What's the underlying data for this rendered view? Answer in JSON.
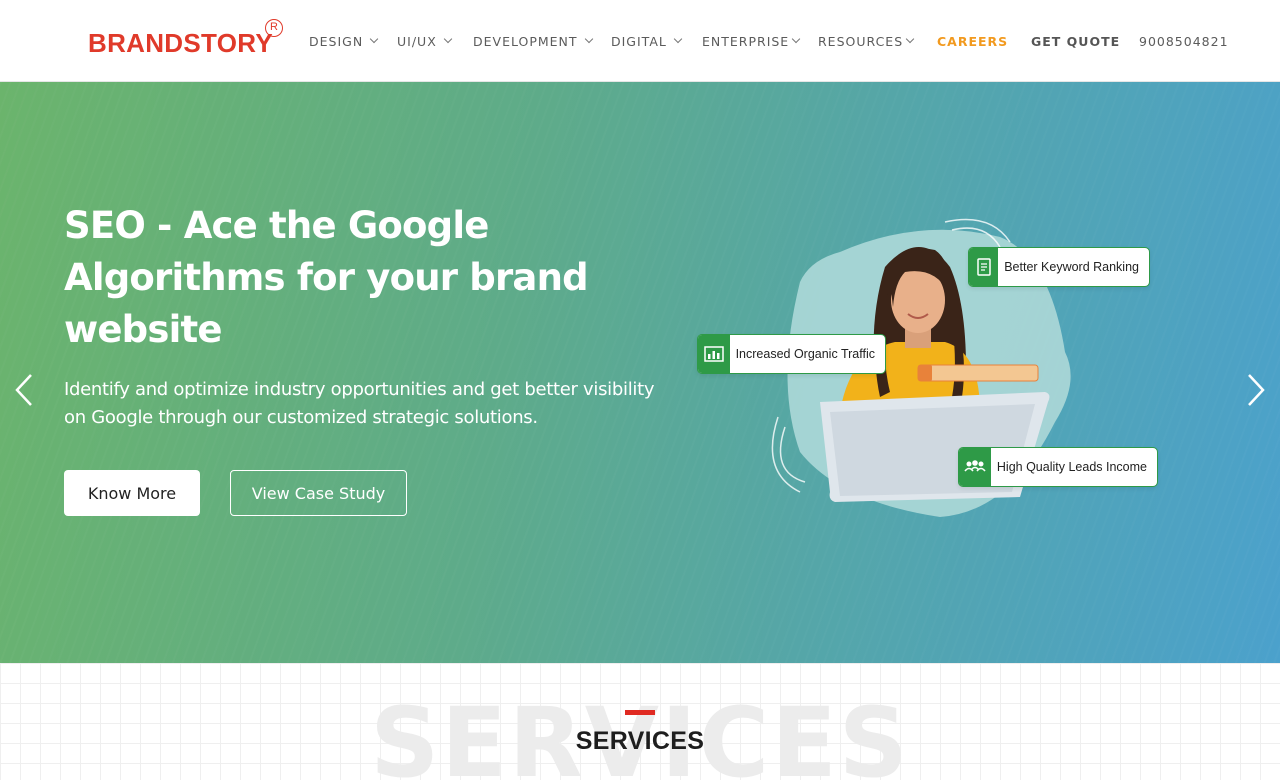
{
  "header": {
    "logo_text": "BRANDSTORY",
    "logo_reg": "R",
    "nav": [
      {
        "label": "DESIGN",
        "has_dropdown": true
      },
      {
        "label": "UI/UX",
        "has_dropdown": true
      },
      {
        "label": "DEVELOPMENT",
        "has_dropdown": true
      },
      {
        "label": "DIGITAL",
        "has_dropdown": true
      },
      {
        "label": "ENTERPRISE",
        "has_dropdown": true
      },
      {
        "label": "RESOURCES",
        "has_dropdown": true
      }
    ],
    "careers": "CAREERS",
    "get_quote": "GET QUOTE",
    "phone": "9008504821"
  },
  "hero": {
    "title": "SEO - Ace the Google Algorithms for your brand website",
    "subtitle": "Identify and optimize industry opportunities and get better visibility on Google through our customized strategic solutions.",
    "primary_button": "Know More",
    "secondary_button": "View Case Study",
    "badges": {
      "keyword": "Better Keyword Ranking",
      "traffic": "Increased Organic Traffic",
      "leads": "High Quality Leads Income"
    }
  },
  "services": {
    "background_word": "SERVICES",
    "title": "SERVICES"
  },
  "colors": {
    "brand_red": "#e03a2a",
    "careers_orange": "#f29a1f",
    "badge_green": "#2e9a47",
    "hero_gradient_start": "#6bb46c",
    "hero_gradient_end": "#4ba1cc"
  },
  "icons": [
    "chevron-down-icon",
    "chevron-left-icon",
    "chevron-right-icon",
    "document-icon",
    "chart-icon",
    "people-icon"
  ]
}
